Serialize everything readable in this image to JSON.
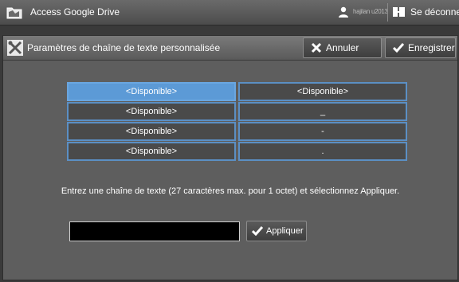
{
  "topbar": {
    "app_title": "Access Google Drive",
    "app_icon": "folder-icon",
    "user_name": "hajilan u2013",
    "logout_label": "Se déconnecter"
  },
  "panel": {
    "title": "Paramètres de chaîne de texte personnalisée",
    "cancel_label": "Annuler",
    "save_label": "Enregistrer"
  },
  "grid": {
    "rows": [
      {
        "left": "<Disponible>",
        "right": "<Disponible>"
      },
      {
        "left": "<Disponible>",
        "right": "_"
      },
      {
        "left": "<Disponible>",
        "right": "-"
      },
      {
        "left": "<Disponible>",
        "right": "."
      }
    ]
  },
  "instruction": "Entrez une chaîne de texte (27 caractères max. pour 1 octet) et sélectionnez Appliquer.",
  "input": {
    "value": ""
  },
  "apply_label": "Appliquer",
  "colors": {
    "accent": "#5c9ad6",
    "border": "#5b8fc4"
  }
}
